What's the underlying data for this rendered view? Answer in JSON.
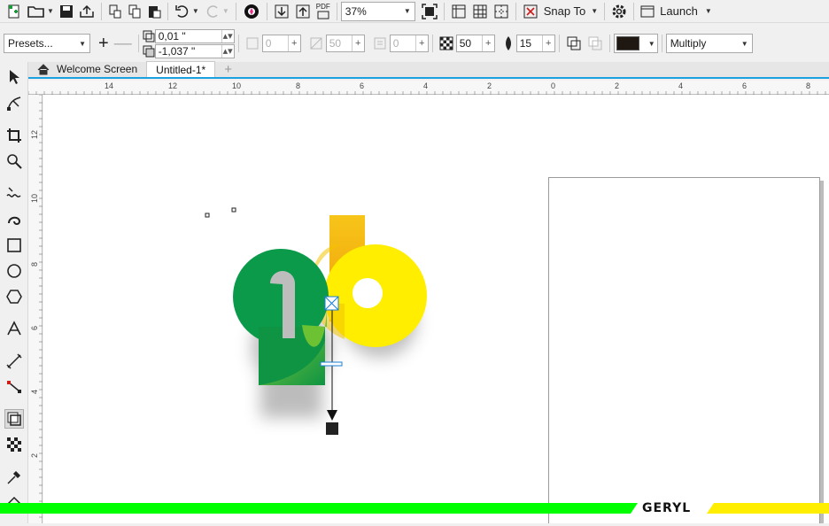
{
  "toolbar_top": {
    "zoom": "37%",
    "snap_label": "Snap To",
    "launch_label": "Launch",
    "pdf_label": "PDF"
  },
  "toolbar_props": {
    "presets": "Presets...",
    "offset_x": "0,01 \"",
    "offset_y": "-1,037 \"",
    "disabled_value_1": "0",
    "disabled_value_2": "50",
    "disabled_value_3": "0",
    "opacity": "50",
    "feather": "15",
    "merge_mode": "Multiply",
    "shadow_color": "#1e1712"
  },
  "tabs": [
    {
      "label": "Welcome Screen",
      "active": false
    },
    {
      "label": "Untitled-1*",
      "active": true
    }
  ],
  "ruler_h_labels": [
    "14",
    "12",
    "10",
    "8",
    "6",
    "4",
    "2",
    "0",
    "2",
    "4",
    "6",
    "8"
  ],
  "ruler_v_labels": [
    "12",
    "10",
    "8",
    "6",
    "4",
    "2"
  ],
  "logo": {
    "colors": {
      "green": "#0b9a4a",
      "green_light": "#5bbf2a",
      "yellow": "#ffee00",
      "orange": "#f4b80e"
    }
  },
  "brand": {
    "text": "GERYL",
    "green": "#00ff00",
    "yellow": "#ffee00"
  }
}
